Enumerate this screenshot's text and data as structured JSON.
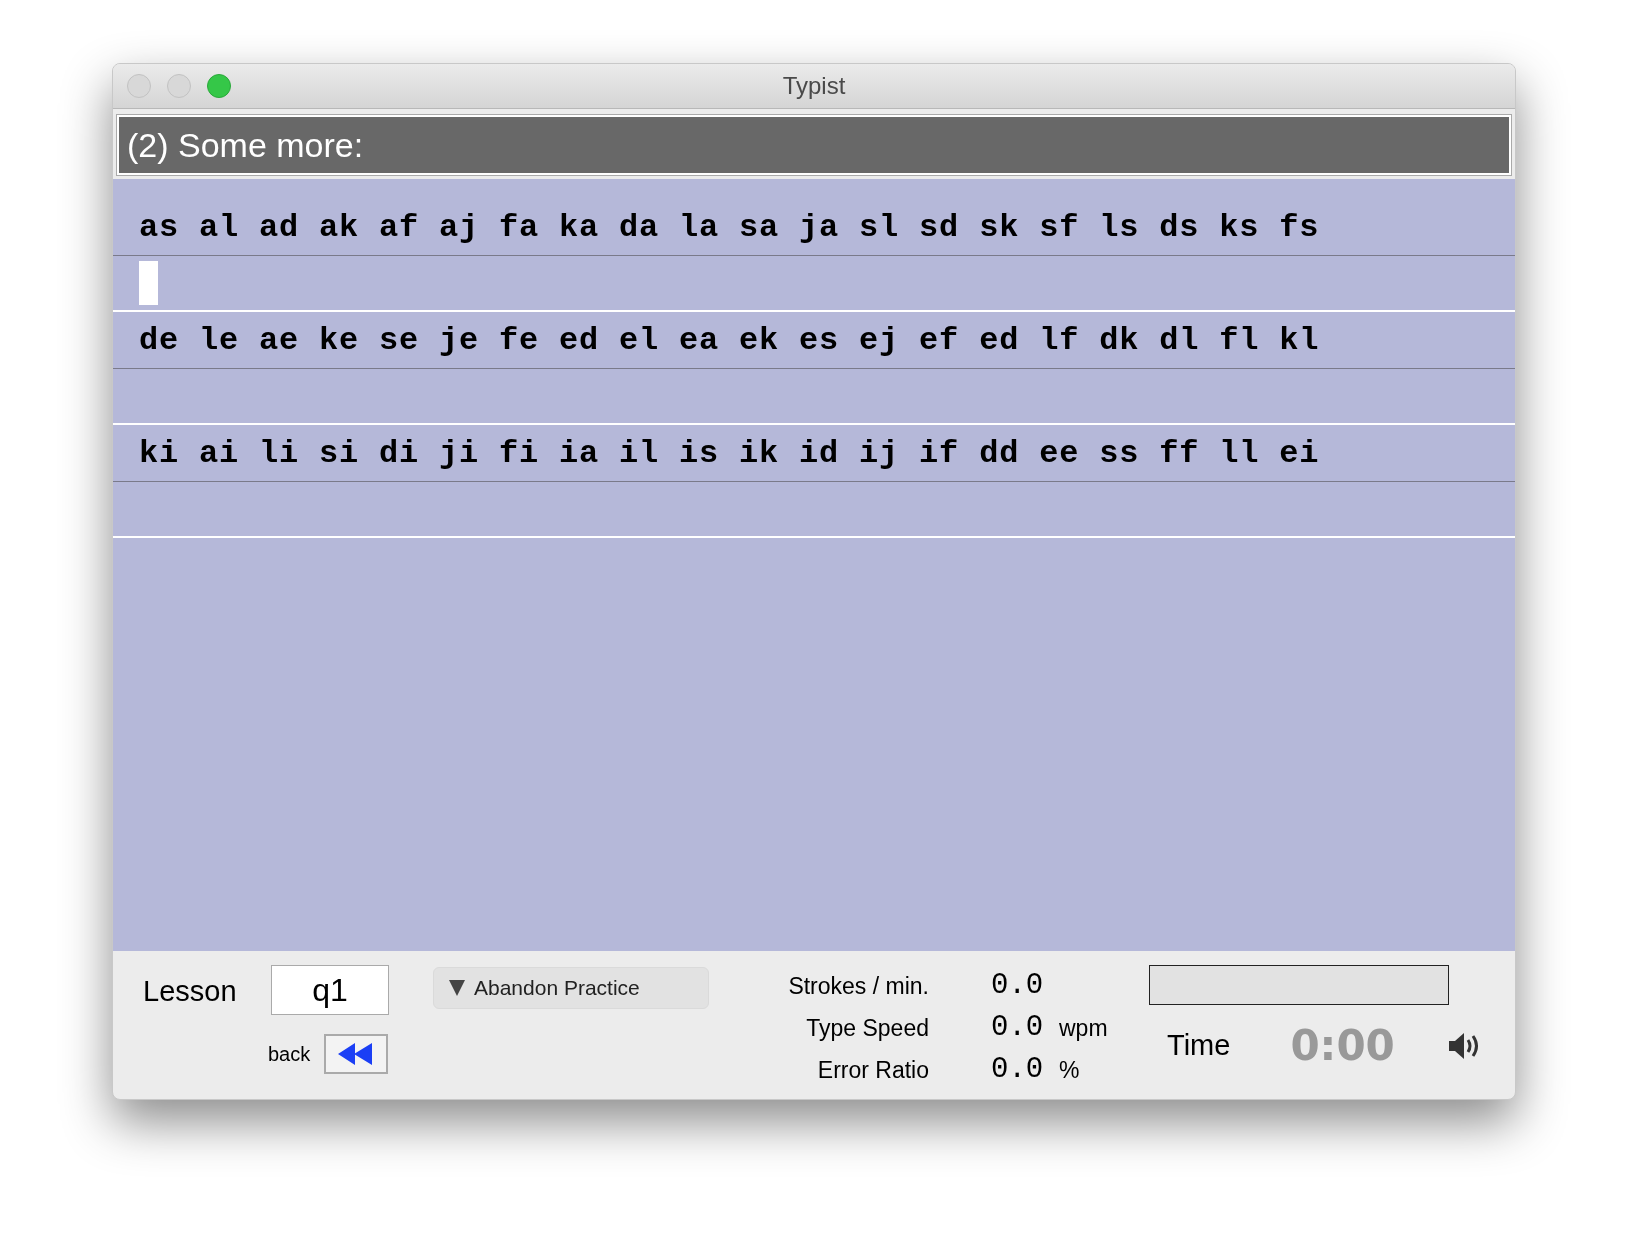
{
  "window": {
    "title": "Typist"
  },
  "lesson_heading": "(2) Some more:",
  "lines": [
    {
      "text": "as al ad ak af aj fa ka da la sa ja sl sd sk sf ls ds ks fs",
      "cursor": true
    },
    {
      "text": "de le ae ke se je fe ed el ea ek es ej ef ed lf dk dl fl kl",
      "cursor": false
    },
    {
      "text": "ki ai li si di ji fi ia il is ik id ij if dd ee ss ff ll ei",
      "cursor": false
    }
  ],
  "controls": {
    "lesson_label": "Lesson",
    "lesson_value": "q1",
    "back_label": "back",
    "mode_button": "Abandon Practice"
  },
  "stats": [
    {
      "label": "Strokes / min.",
      "value": "0.0"
    },
    {
      "label": "Type Speed",
      "value": "0.0",
      "unit": "wpm"
    },
    {
      "label": "Error Ratio",
      "value": "0.0",
      "unit": "%"
    }
  ],
  "progress": {
    "level": 0
  },
  "time": {
    "label": "Time",
    "value": "0:00",
    "sound_on": true
  }
}
